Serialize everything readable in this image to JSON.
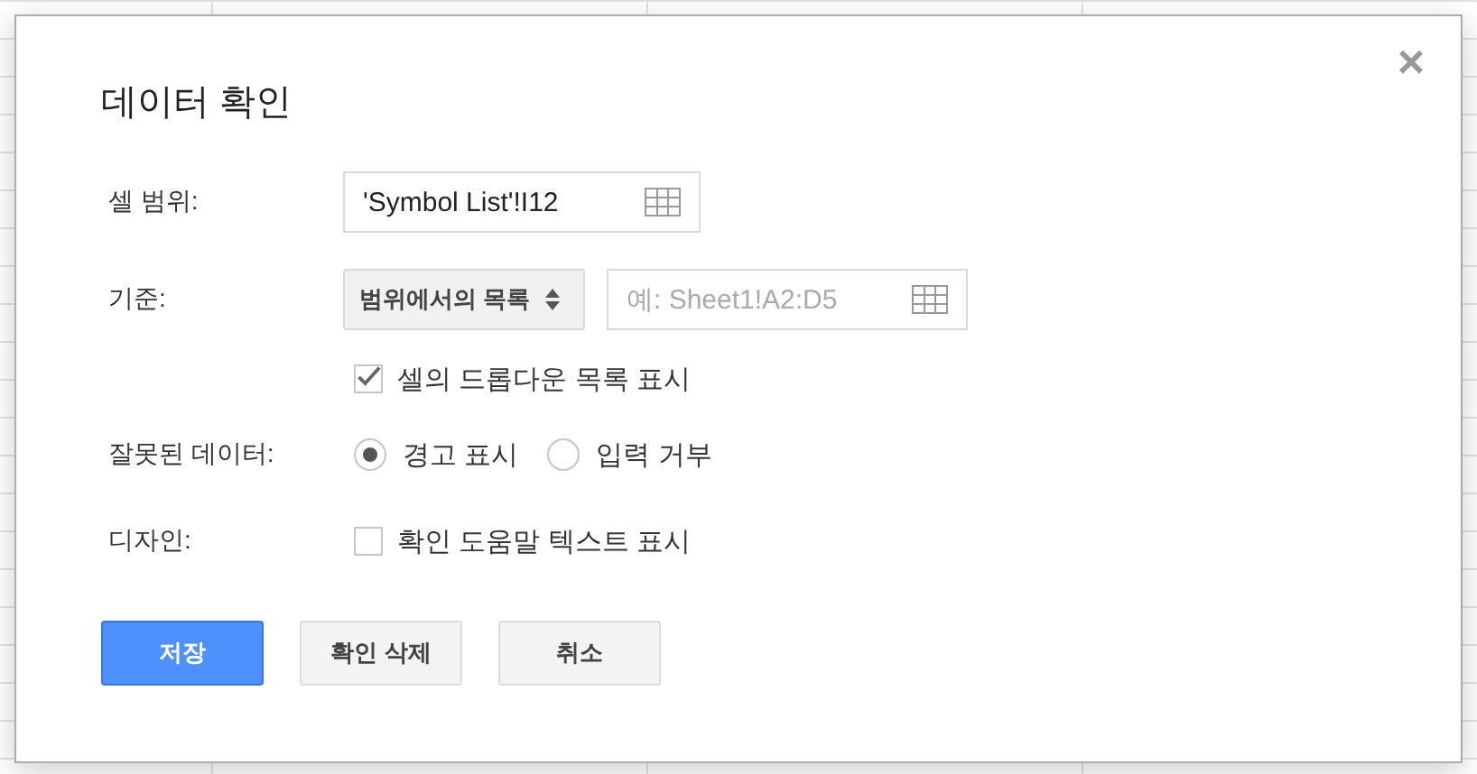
{
  "dialog": {
    "title": "데이터 확인",
    "close": "×"
  },
  "cell_range": {
    "label": "셀 범위:",
    "value": "'Symbol List'!I12"
  },
  "criteria": {
    "label": "기준:",
    "dropdown": "범위에서의 목록",
    "range": {
      "placeholder": "예: Sheet1!A2:D5"
    }
  },
  "show_dropdown": {
    "label": "셀의 드롭다운 목록 표시",
    "checked": true
  },
  "invalid_data": {
    "label": "잘못된 데이터:",
    "options": [
      {
        "label": "경고 표시",
        "selected": true
      },
      {
        "label": "입력 거부",
        "selected": false
      }
    ]
  },
  "appearance": {
    "label": "디자인:",
    "checkbox": {
      "label": "확인 도움말 텍스트 표시",
      "checked": false
    }
  },
  "buttons": [
    {
      "label": "저장",
      "kind": "primary"
    },
    {
      "label": "확인 삭제",
      "kind": "secondary"
    },
    {
      "label": "취소",
      "kind": "secondary"
    }
  ]
}
